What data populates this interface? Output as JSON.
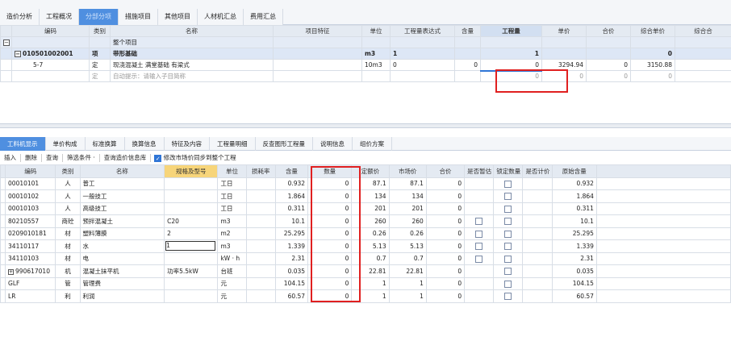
{
  "top_tabs": [
    {
      "label": "造价分析",
      "active": false
    },
    {
      "label": "工程概况",
      "active": false
    },
    {
      "label": "分部分项",
      "active": true
    },
    {
      "label": "措施项目",
      "active": false
    },
    {
      "label": "其他项目",
      "active": false
    },
    {
      "label": "人材机汇总",
      "active": false
    },
    {
      "label": "费用汇总",
      "active": false
    }
  ],
  "upper_headers": [
    "编码",
    "类别",
    "名称",
    "项目特征",
    "单位",
    "工程量表达式",
    "含量",
    "工程量",
    "单价",
    "合价",
    "综合单价",
    "综合合"
  ],
  "upper_rows": [
    {
      "sign": "−",
      "code": "",
      "type": "",
      "name": "整个项目",
      "feature": "",
      "unit": "",
      "expr": "",
      "content": "",
      "qty": "",
      "price": "",
      "total": "",
      "unit_price": "",
      "unit_total": ""
    },
    {
      "sign": "−",
      "code": "010501002001",
      "type": "项",
      "name": "带形基础",
      "feature": "",
      "unit": "m3",
      "expr": "1",
      "content": "",
      "qty": "1",
      "price": "",
      "total": "",
      "unit_price": "0",
      "unit_total": ""
    },
    {
      "sign": "",
      "code": "5-7",
      "type": "定",
      "name": "现浇混凝土 满堂基础 有梁式",
      "feature": "",
      "unit": "10m3",
      "expr": "0",
      "content": "0",
      "qty": "0",
      "price": "3294.94",
      "total": "0",
      "unit_price": "3150.88",
      "unit_total": ""
    },
    {
      "sign": "",
      "code": "",
      "type": "定",
      "name": "自动提示：请输入子目简称",
      "feature": "",
      "unit": "",
      "expr": "",
      "content": "",
      "qty": "0",
      "price": "0",
      "total": "0",
      "unit_price": "0",
      "unit_total": ""
    }
  ],
  "bottom_tabs": [
    {
      "label": "工料机显示",
      "active": true
    },
    {
      "label": "单价构成",
      "active": false
    },
    {
      "label": "标准换算",
      "active": false
    },
    {
      "label": "换算信息",
      "active": false
    },
    {
      "label": "特征及内容",
      "active": false
    },
    {
      "label": "工程量明细",
      "active": false
    },
    {
      "label": "反查图形工程量",
      "active": false
    },
    {
      "label": "说明信息",
      "active": false
    },
    {
      "label": "组价方案",
      "active": false
    }
  ],
  "toolbar": {
    "insert": "插入",
    "delete": "删除",
    "query": "查询",
    "filter": "筛选条件 ·",
    "price_lib": "查询造价信息库",
    "sync_label": "修改市场价同步到整个工程"
  },
  "lower_headers": [
    "编码",
    "类别",
    "名称",
    "规格及型号",
    "单位",
    "损耗率",
    "含量",
    "数量",
    "定额价",
    "市场价",
    "合价",
    "是否暂估",
    "锁定数量",
    "是否计价",
    "原始含量"
  ],
  "lower_rows": [
    {
      "code": "00010101",
      "type": "人",
      "name": "普工",
      "spec": "",
      "unit": "工日",
      "loss": "",
      "content": "0.932",
      "qty": "0",
      "quota": "87.1",
      "market": "87.1",
      "total": "0",
      "est": false,
      "lock": true,
      "priced": false,
      "orig": "0.932"
    },
    {
      "code": "00010102",
      "type": "人",
      "name": "一般技工",
      "spec": "",
      "unit": "工日",
      "loss": "",
      "content": "1.864",
      "qty": "0",
      "quota": "134",
      "market": "134",
      "total": "0",
      "est": false,
      "lock": true,
      "priced": false,
      "orig": "1.864"
    },
    {
      "code": "00010103",
      "type": "人",
      "name": "高级技工",
      "spec": "",
      "unit": "工日",
      "loss": "",
      "content": "0.311",
      "qty": "0",
      "quota": "201",
      "market": "201",
      "total": "0",
      "est": false,
      "lock": true,
      "priced": false,
      "orig": "0.311"
    },
    {
      "code": "80210557",
      "type": "商砼",
      "name": "预拌混凝土",
      "spec": "C20",
      "unit": "m3",
      "loss": "",
      "content": "10.1",
      "qty": "0",
      "quota": "260",
      "market": "260",
      "total": "0",
      "est": true,
      "lock": true,
      "priced": false,
      "orig": "10.1"
    },
    {
      "code": "0209010181",
      "type": "材",
      "name": "塑料薄膜",
      "spec": "2",
      "unit": "m2",
      "loss": "",
      "content": "25.295",
      "qty": "0",
      "quota": "0.26",
      "market": "0.26",
      "total": "0",
      "est": true,
      "lock": true,
      "priced": false,
      "orig": "25.295"
    },
    {
      "code": "34110117",
      "type": "材",
      "name": "水",
      "spec": "1",
      "unit": "m3",
      "loss": "",
      "content": "1.339",
      "qty": "0",
      "quota": "5.13",
      "market": "5.13",
      "total": "0",
      "est": true,
      "lock": true,
      "priced": false,
      "orig": "1.339"
    },
    {
      "code": "34110103",
      "type": "材",
      "name": "电",
      "spec": "",
      "unit": "kW · h",
      "loss": "",
      "content": "2.31",
      "qty": "0",
      "quota": "0.7",
      "market": "0.7",
      "total": "0",
      "est": true,
      "lock": true,
      "priced": false,
      "orig": "2.31"
    },
    {
      "code": "990617010",
      "type": "机",
      "name": "混凝土抹平机",
      "spec": "功率5.5kW",
      "unit": "台班",
      "loss": "",
      "content": "0.035",
      "qty": "0",
      "quota": "22.81",
      "market": "22.81",
      "total": "0",
      "est": false,
      "lock": true,
      "priced": false,
      "orig": "0.035"
    },
    {
      "code": "GLF",
      "type": "管",
      "name": "管理费",
      "spec": "",
      "unit": "元",
      "loss": "",
      "content": "104.15",
      "qty": "0",
      "quota": "1",
      "market": "1",
      "total": "0",
      "est": false,
      "lock": true,
      "priced": false,
      "orig": "104.15"
    },
    {
      "code": "LR",
      "type": "利",
      "name": "利润",
      "spec": "",
      "unit": "元",
      "loss": "",
      "content": "60.57",
      "qty": "0",
      "quota": "1",
      "market": "1",
      "total": "0",
      "est": false,
      "lock": true,
      "priced": false,
      "orig": "60.57"
    }
  ],
  "colors": {
    "accent": "#4f8fe0",
    "highlight_box": "#e02020"
  }
}
